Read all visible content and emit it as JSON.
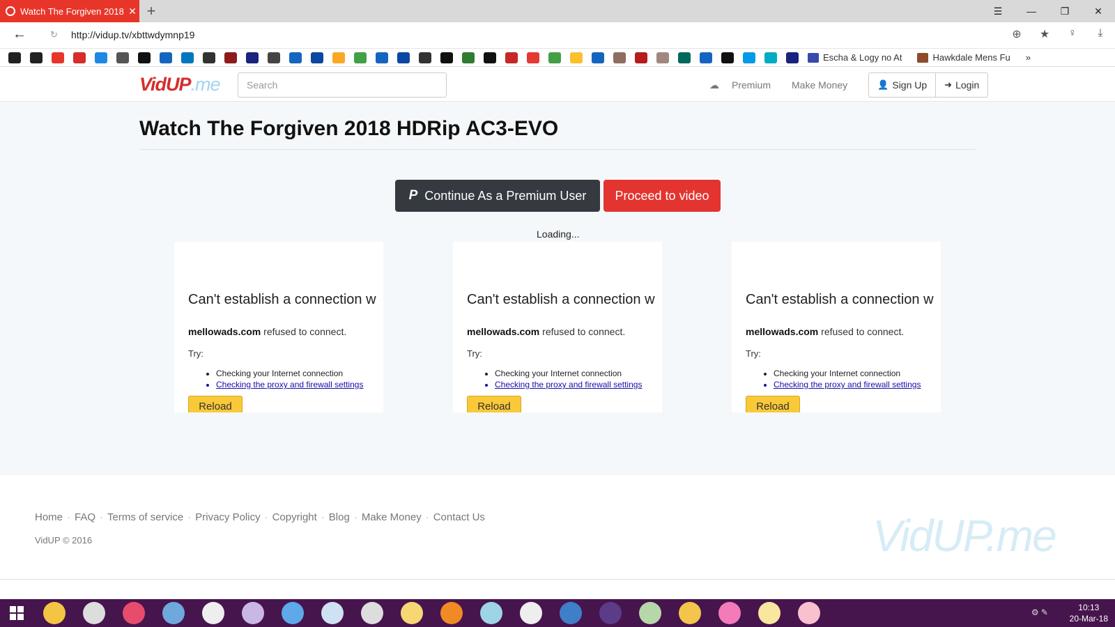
{
  "browser": {
    "tab_title": "Watch The Forgiven 2018",
    "url": "http://vidup.tv/xbttwdymnp19",
    "bookmarks": [
      {
        "label": "Escha & Logy no At"
      },
      {
        "label": "Hawkdale Mens Fu"
      }
    ],
    "more_bookmarks": "»"
  },
  "site": {
    "logo_main": "VidUP",
    "logo_suffix": ".me",
    "search_placeholder": "Search",
    "nav": {
      "premium": "Premium",
      "make_money": "Make Money",
      "signup": "Sign Up",
      "login": "Login"
    }
  },
  "page": {
    "title": "Watch The Forgiven 2018 HDRip AC3-EVO",
    "btn_premium": "Continue As a Premium User",
    "btn_proceed": "Proceed to video",
    "loading": "Loading...",
    "error_frame": {
      "heading": "Can't establish a connection w",
      "domain": "mellowads.com",
      "message": " refused to connect.",
      "try_label": "Try:",
      "tip1": "Checking your Internet connection",
      "tip2": "Checking the proxy and firewall settings",
      "reload_label": "Reload"
    }
  },
  "footer": {
    "links": [
      "Home",
      "FAQ",
      "Terms of service",
      "Privacy Policy",
      "Copyright",
      "Blog",
      "Make Money",
      "Contact Us"
    ],
    "copyright": "VidUP © 2016",
    "watermark": "VidUP.me"
  },
  "taskbar": {
    "time": "10:13",
    "date": "20-Mar-18"
  },
  "colors": {
    "tab_active": "#e8352a",
    "brand_red": "#d62d2d",
    "proceed_button": "#e3342f",
    "premium_button": "#343a40",
    "reload_button": "#f9c93a",
    "taskbar": "#47154d"
  }
}
